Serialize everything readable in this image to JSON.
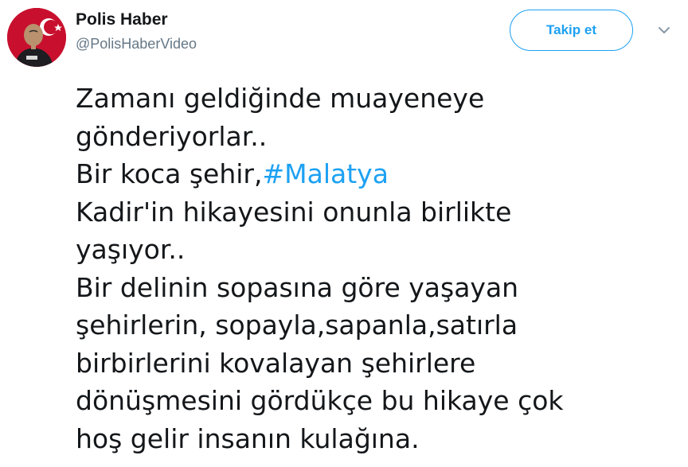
{
  "author": {
    "display_name": "Polis Haber",
    "handle": "@PolisHaberVideo"
  },
  "follow_button": {
    "label": "Takip et"
  },
  "menu": {
    "icon": "chevron-down-icon"
  },
  "tweet": {
    "lines": [
      "Zamanı geldiğinde muayeneye",
      "gönderiyorlar..",
      "Bir koca şehir,",
      "Kadir'in hikayesini onunla birlikte",
      "yaşıyor..",
      "Bir delinin sopasına göre yaşayan",
      "şehirlerin, sopayla,sapanla,satırla",
      "birbirlerini kovalayan şehirlere",
      "dönüşmesini gördükçe bu hikaye çok",
      "hoş gelir insanın kulağına."
    ],
    "hashtag": "#Malatya"
  },
  "colors": {
    "accent": "#1da1f2",
    "text": "#14171a",
    "secondary_text": "#657786",
    "avatar_red": "#c8102e"
  }
}
